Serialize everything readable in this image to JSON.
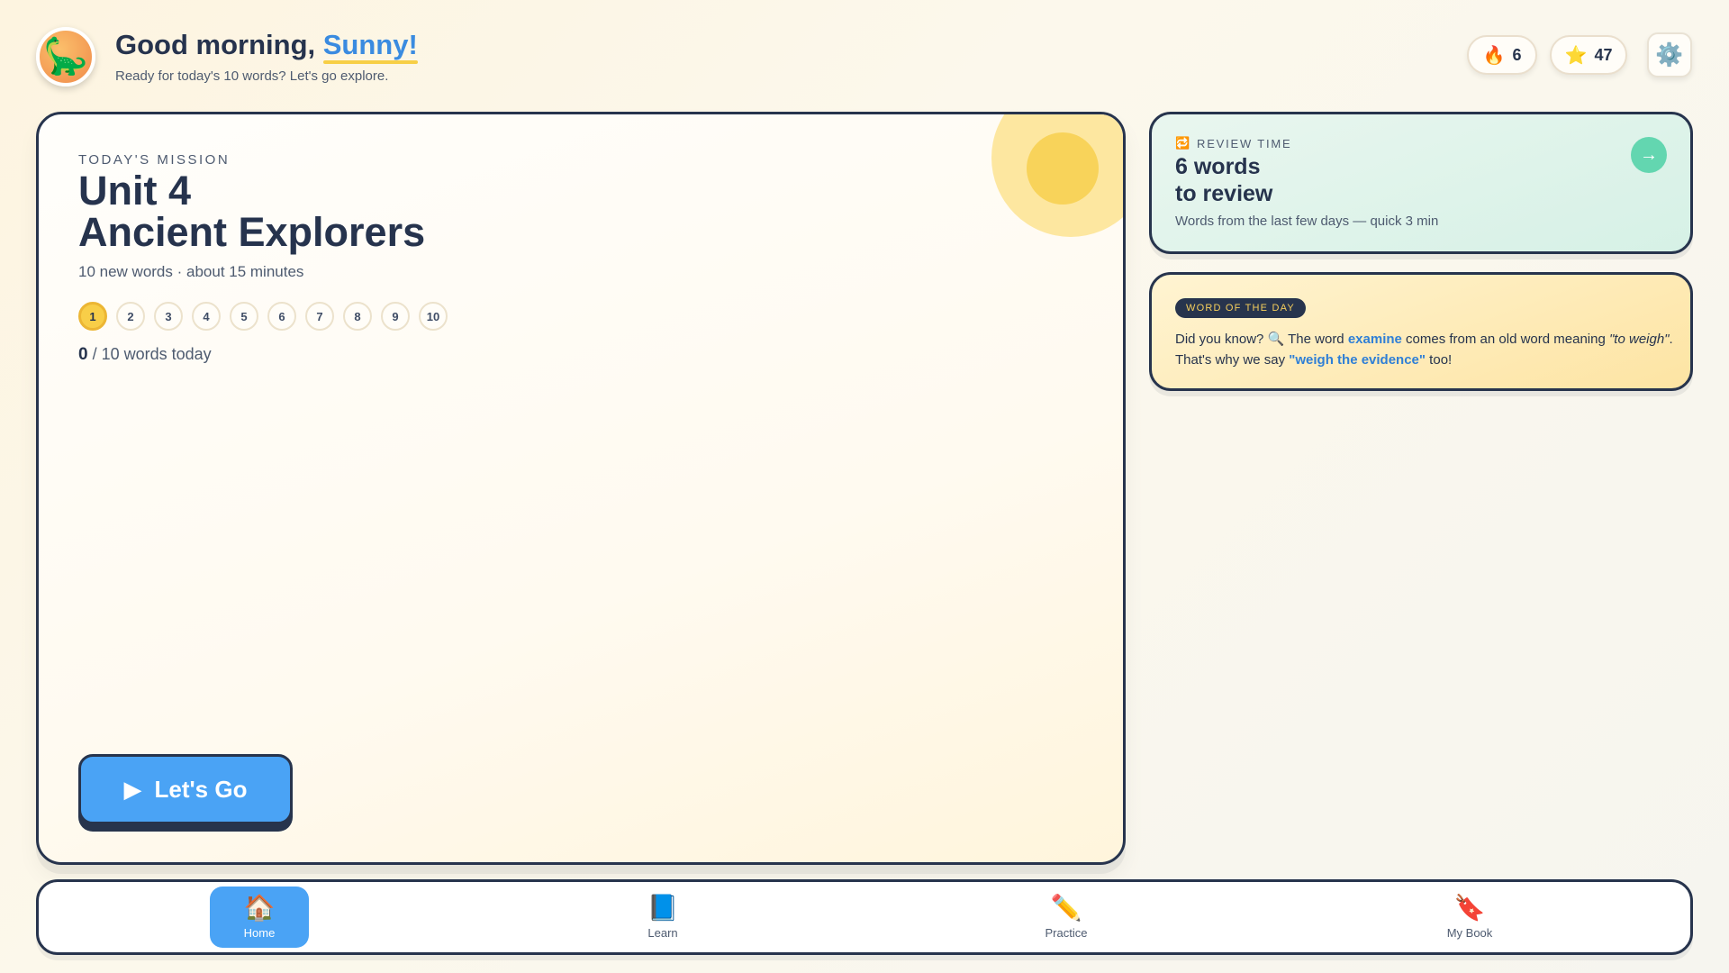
{
  "header": {
    "avatar_emoji": "🦕",
    "greeting_prefix": "Good morning, ",
    "user_name": "Sunny!",
    "subtitle": "Ready for today's 10 words? Let's go explore.",
    "streak": {
      "icon": "fire-icon",
      "glyph": "🔥",
      "value": "6"
    },
    "stars": {
      "icon": "star-icon",
      "glyph": "⭐",
      "value": "47"
    },
    "settings": {
      "icon": "gear-icon",
      "glyph": "⚙️"
    }
  },
  "mission": {
    "label": "TODAY'S MISSION",
    "unit": "Unit 4",
    "title": "Ancient Explorers",
    "meta": "10 new words · about 15 minutes",
    "steps": [
      "1",
      "2",
      "3",
      "4",
      "5",
      "6",
      "7",
      "8",
      "9",
      "10"
    ],
    "current_step": 1,
    "done_count": "0",
    "progress_suffix": " / 10 words today",
    "button_glyph": "▶",
    "button_label": "Let's Go"
  },
  "review": {
    "icon_glyph": "🔁",
    "label": "REVIEW TIME",
    "title_line1": "6 words",
    "title_line2": "to review",
    "subtitle": "Words from the last few days — quick 3 min",
    "arrow": "→"
  },
  "word_of_day": {
    "tag": "WORD OF THE DAY",
    "text_1": "Did you know? 🔍 The word ",
    "word": "examine",
    "text_2": " comes from an old word meaning ",
    "meaning": "\"to weigh\"",
    "text_3": ". That's why we say ",
    "phrase": "\"weigh the evidence\"",
    "text_4": " too!"
  },
  "nav": {
    "active": "home",
    "items": [
      {
        "id": "home",
        "label": "Home",
        "glyph": "🏠",
        "icon": "house-icon"
      },
      {
        "id": "learn",
        "label": "Learn",
        "glyph": "📘",
        "icon": "book-icon"
      },
      {
        "id": "practice",
        "label": "Practice",
        "glyph": "✏️",
        "icon": "pencil-icon"
      },
      {
        "id": "mybook",
        "label": "My Book",
        "glyph": "🔖",
        "icon": "bookmark-icon"
      }
    ]
  }
}
